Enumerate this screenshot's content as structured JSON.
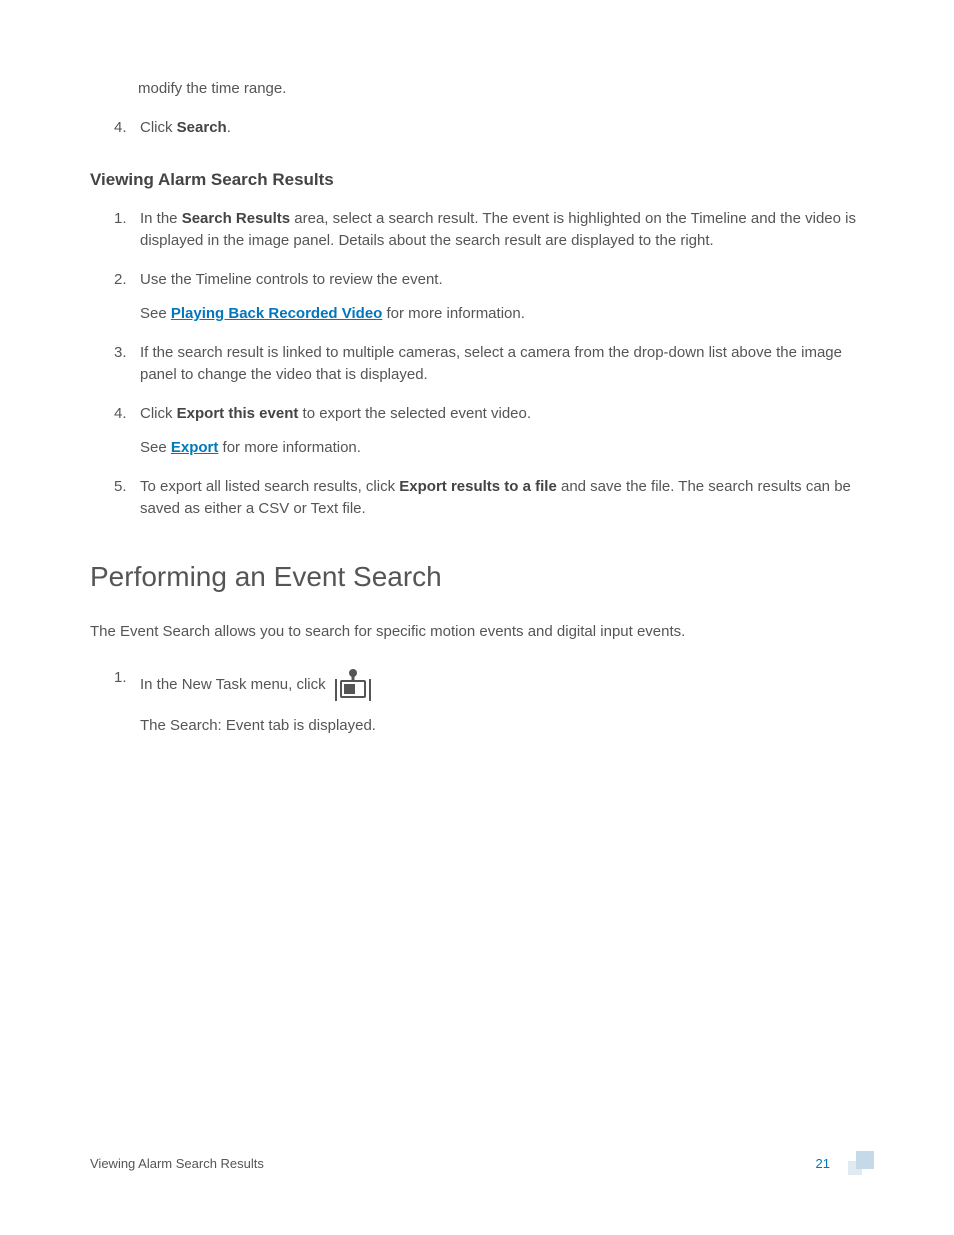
{
  "continued_text": "modify the time range.",
  "step4_prefix": "Click ",
  "step4_bold": "Search",
  "step4_suffix": ".",
  "heading_viewing": "Viewing Alarm Search Results",
  "viewing": {
    "s1_a": "In the ",
    "s1_b": "Search Results",
    "s1_c": " area, select a search result. The event is highlighted on the Timeline and the video is displayed in the image panel. Details about the search result are displayed to the right.",
    "s2_a": "Use the Timeline controls to review the event.",
    "s2_see": "See ",
    "s2_link": "Playing Back Recorded Video",
    "s2_after": " for more information.",
    "s3": "If the search result is linked to multiple cameras, select a camera from the drop-down list above the image panel to change the video that is displayed.",
    "s4_a": "Click ",
    "s4_b": "Export this event",
    "s4_c": " to export the selected event video.",
    "s4_see": "See ",
    "s4_link": "Export",
    "s4_after": " for more information.",
    "s5_a": "To export all listed search results, click ",
    "s5_b": "Export results to a file",
    "s5_c": " and save the file. The search results can be saved as either a CSV or Text file."
  },
  "heading_event": "Performing an Event Search",
  "event_intro": "The Event Search allows you to search for specific motion events and digital input events.",
  "event_s1_a": "In the New Task menu, click",
  "event_s1_icon": "event-search-icon",
  "event_s1_sub": "The Search: Event tab is displayed.",
  "footer_title": "Viewing Alarm Search Results",
  "page_number": "21"
}
